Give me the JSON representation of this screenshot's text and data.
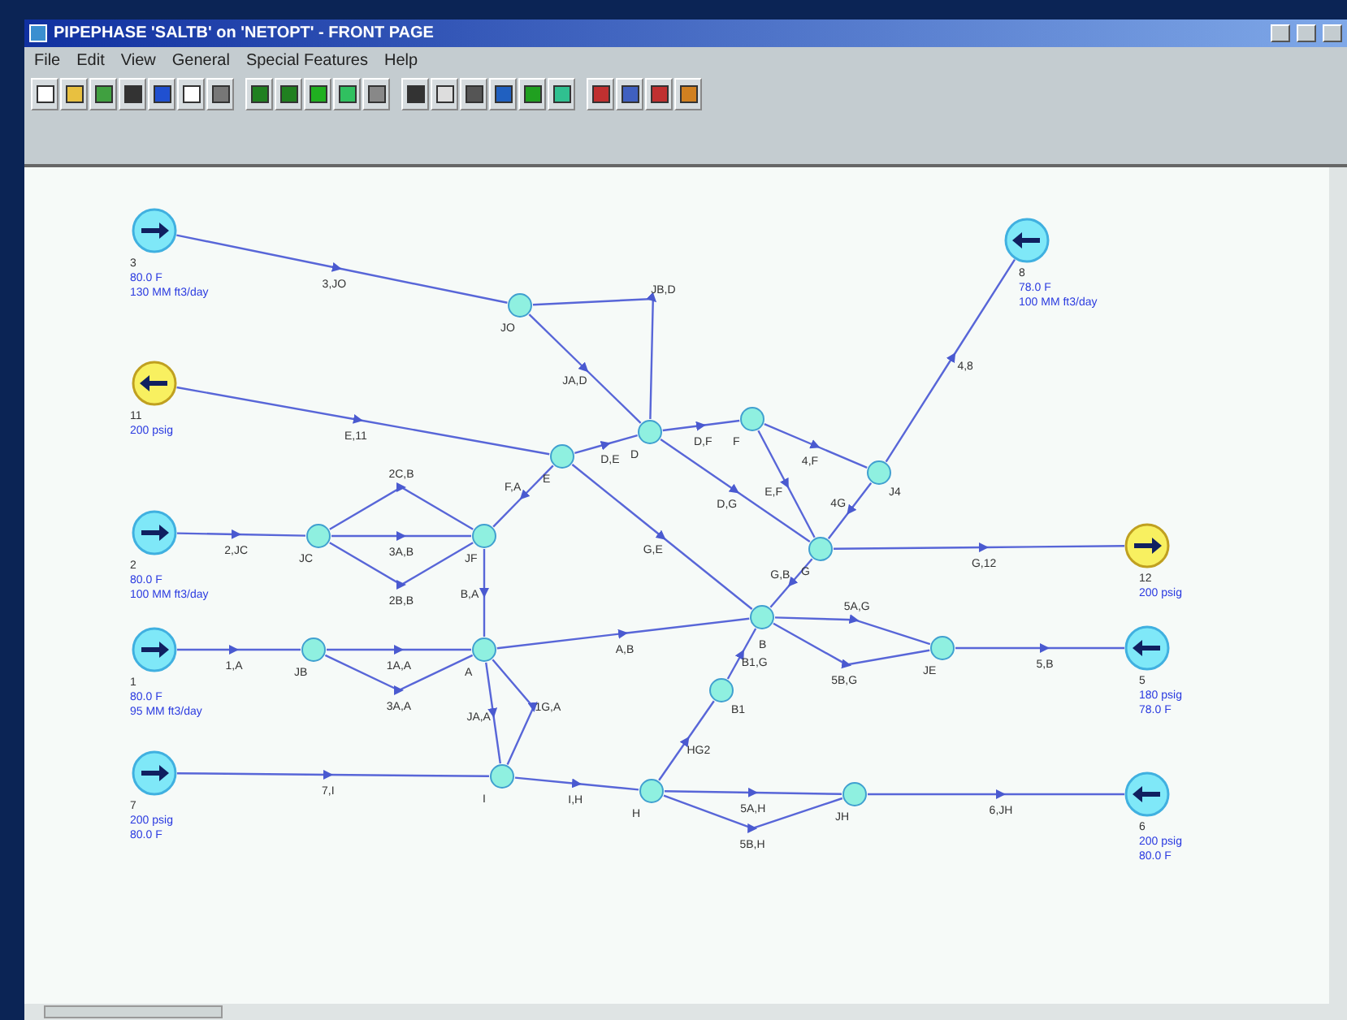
{
  "window": {
    "title": "PIPEPHASE 'SALTB' on 'NETOPT' - FRONT PAGE"
  },
  "menu": [
    "File",
    "Edit",
    "View",
    "General",
    "Special Features",
    "Help"
  ],
  "sources": [
    {
      "label": "3",
      "kind": "flow",
      "inflow": true,
      "info": [
        "80.0 F",
        "130 MM ft3/day"
      ]
    },
    {
      "label": "11",
      "kind": "pressure",
      "inflow": false,
      "info": [
        "200 psig"
      ]
    },
    {
      "label": "2",
      "kind": "flow",
      "inflow": true,
      "info": [
        "80.0 F",
        "100 MM ft3/day"
      ]
    },
    {
      "label": "1",
      "kind": "flow",
      "inflow": true,
      "info": [
        "80.0 F",
        "95 MM ft3/day"
      ]
    },
    {
      "label": "7",
      "kind": "flow",
      "inflow": true,
      "info": [
        "200 psig",
        "80.0 F"
      ]
    },
    {
      "label": "8",
      "kind": "flow",
      "inflow": true,
      "info": [
        "78.0 F",
        "100 MM ft3/day"
      ]
    },
    {
      "label": "12",
      "kind": "pressure",
      "inflow": false,
      "info": [
        "200 psig"
      ]
    },
    {
      "label": "5",
      "kind": "flow",
      "inflow": true,
      "info": [
        "180 psig",
        "78.0 F"
      ]
    },
    {
      "label": "6",
      "kind": "flow",
      "inflow": true,
      "info": [
        "200 psig",
        "80.0 F"
      ]
    }
  ],
  "junctions": [
    {
      "label": "JO"
    },
    {
      "label": "E"
    },
    {
      "label": "D"
    },
    {
      "label": "F"
    },
    {
      "label": "J4"
    },
    {
      "label": "JC"
    },
    {
      "label": "JF"
    },
    {
      "label": "G"
    },
    {
      "label": "JB"
    },
    {
      "label": "A"
    },
    {
      "label": "B"
    },
    {
      "label": "JE"
    },
    {
      "label": "B1"
    },
    {
      "label": "I"
    },
    {
      "label": "H"
    },
    {
      "label": "JH"
    }
  ],
  "links": [
    {
      "label": "3,JO"
    },
    {
      "label": "JB,D"
    },
    {
      "label": "JA,D"
    },
    {
      "label": "E,11"
    },
    {
      "label": "D,E"
    },
    {
      "label": "D,F"
    },
    {
      "label": "4,F"
    },
    {
      "label": "D,G"
    },
    {
      "label": "E,F"
    },
    {
      "label": "4G"
    },
    {
      "label": "4,8"
    },
    {
      "label": "G,12"
    },
    {
      "label": "F,A"
    },
    {
      "label": "2,JC"
    },
    {
      "label": "G,E"
    },
    {
      "label": "2C,B"
    },
    {
      "label": "3A,B"
    },
    {
      "label": "2B,B"
    },
    {
      "label": "B,A"
    },
    {
      "label": "1,A"
    },
    {
      "label": "1A,A"
    },
    {
      "label": "3A,A"
    },
    {
      "label": "A,B"
    },
    {
      "label": "JA,A"
    },
    {
      "label": "1G,A"
    },
    {
      "label": "7,I"
    },
    {
      "label": "I,H"
    },
    {
      "label": "HG2"
    },
    {
      "label": "B1,G"
    },
    {
      "label": "5A,G"
    },
    {
      "label": "5B,G"
    },
    {
      "label": "5,B"
    },
    {
      "label": "5A,H"
    },
    {
      "label": "5B,H"
    },
    {
      "label": "6,JH"
    },
    {
      "label": "G,B"
    }
  ]
}
